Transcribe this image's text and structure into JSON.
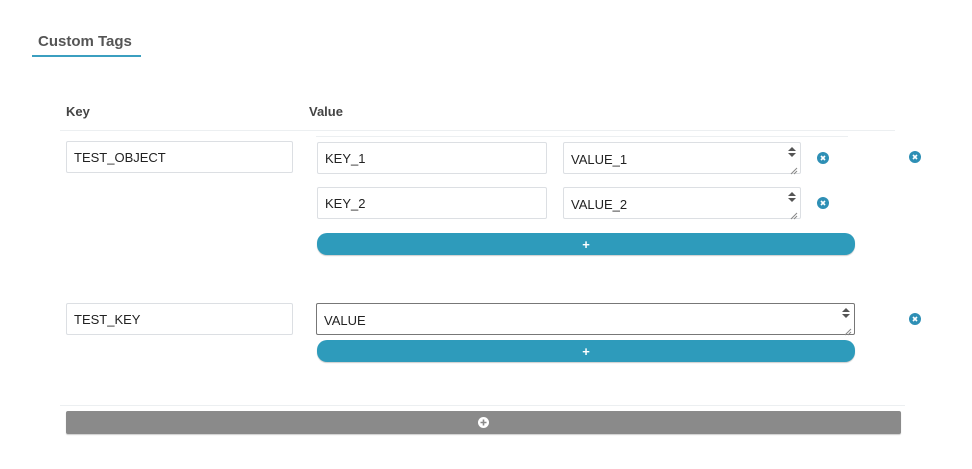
{
  "section": {
    "title": "Custom Tags"
  },
  "columns": {
    "key": "Key",
    "value": "Value"
  },
  "rows": [
    {
      "key": "TEST_OBJECT",
      "nested": [
        {
          "key": "KEY_1",
          "value": "VALUE_1"
        },
        {
          "key": "KEY_2",
          "value": "VALUE_2"
        }
      ],
      "add_label": "+"
    },
    {
      "key": "TEST_KEY",
      "value": "VALUE",
      "add_label": "+"
    }
  ],
  "icons": {
    "remove": "close-circle-icon",
    "add_row": "plus-circle-icon"
  },
  "colors": {
    "accent": "#2e9bbb",
    "remove_icon": "#2e8fb5",
    "add_row_button": "#8a8a8a",
    "title_underline": "#3b9fc0"
  }
}
